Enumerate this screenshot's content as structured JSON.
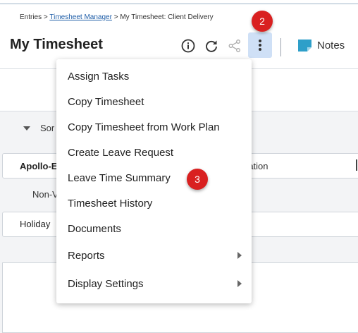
{
  "breadcrumb": {
    "root": "Entries",
    "sep1": ">",
    "link": "Timesheet Manager",
    "sep2": ">",
    "current": "My Timesheet: Client Delivery"
  },
  "header": {
    "title": "My Timesheet",
    "notes_label": "Notes",
    "icons": [
      "info-icon",
      "refresh-icon",
      "share-icon",
      "more-vertical-icon",
      "note-icon"
    ]
  },
  "badges": {
    "step2": "2",
    "step3": "3",
    "color": "#d92020"
  },
  "background": {
    "sort_label": "Sor",
    "card_left": "Apollo-E",
    "card_right": "ration",
    "nonw_label": "Non-V",
    "holiday_label": "Holiday"
  },
  "menu": {
    "items": [
      {
        "label": "Assign Tasks"
      },
      {
        "label": "Copy Timesheet"
      },
      {
        "label": "Copy Timesheet from Work Plan"
      },
      {
        "label": "Create Leave Request"
      },
      {
        "label": "Leave Time Summary"
      },
      {
        "label": "Timesheet History"
      },
      {
        "label": "Documents"
      },
      {
        "label": "Reports",
        "submenu": true
      },
      {
        "label": "Display Settings",
        "submenu": true
      }
    ]
  },
  "colors": {
    "accent": "#1f5ea8",
    "active_button": "#cfe0f6",
    "notes_icon": "#2e9fc9"
  }
}
